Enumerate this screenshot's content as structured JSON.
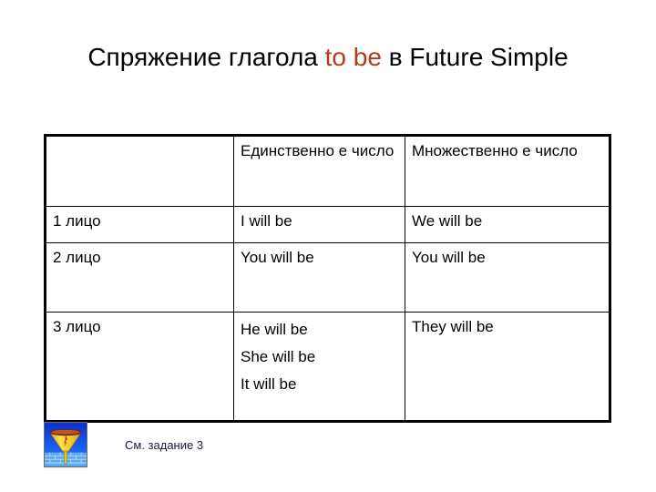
{
  "slide": {
    "title_part1": "Спряжение глагола ",
    "title_accent": "to be",
    "title_part2": " в Future Simple",
    "accent_color": "#B33A1A"
  },
  "table": {
    "columns": [
      "",
      "Единственное число",
      "Множественное число"
    ],
    "header": {
      "corner": "",
      "singular": "Единственно е число",
      "plural": "Множественно е число"
    },
    "rows": [
      {
        "person": "1 лицо",
        "singular": "I will be",
        "plural": "We will be"
      },
      {
        "person": "2 лицо",
        "singular": "You will be",
        "plural": "You will be"
      },
      {
        "person": "3 лицо",
        "singular_lines": [
          "He will be",
          "She will be",
          "It will be"
        ],
        "singular_line_1": "He will be",
        "singular_line_2": "She will be",
        "singular_line_3": "It will be",
        "plural": "They will be"
      }
    ]
  },
  "footer": {
    "icon_name": "filter-funnel-icon",
    "caption": "См. задание 3"
  }
}
